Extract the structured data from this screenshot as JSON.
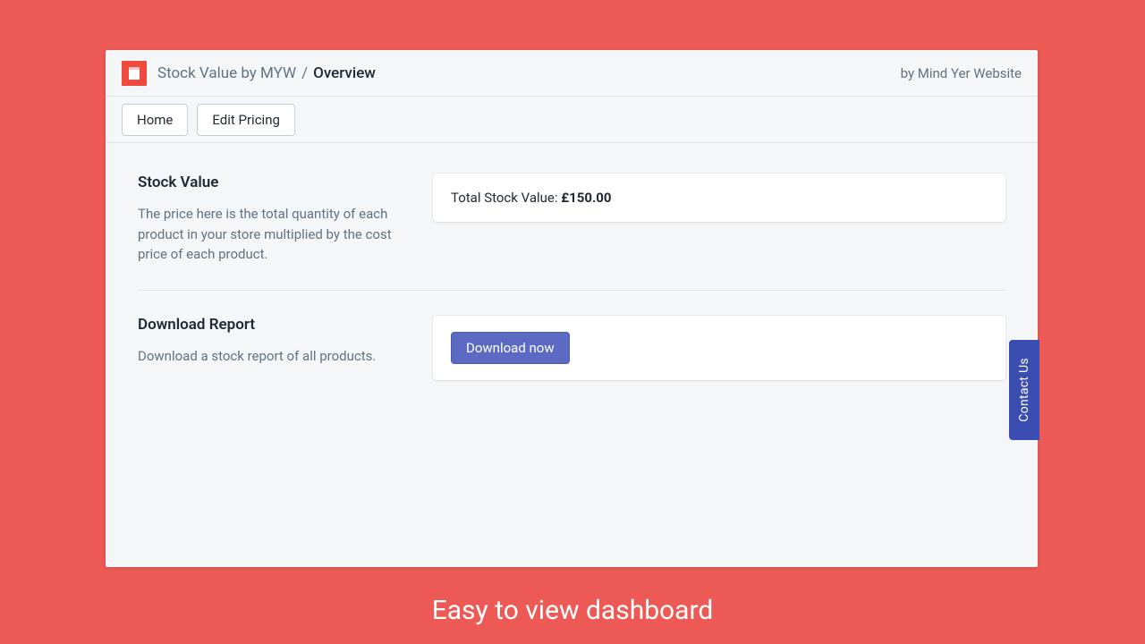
{
  "header": {
    "app_name": "Stock Value by MYW",
    "separator": "/",
    "current_page": "Overview",
    "byline": "by Mind Yer Website"
  },
  "toolbar": {
    "home_label": "Home",
    "edit_pricing_label": "Edit Pricing"
  },
  "sections": {
    "stock_value": {
      "title": "Stock Value",
      "description": "The price here is the total quantity of each product in your store multiplied by the cost price of each product.",
      "total_label": "Total Stock Value: ",
      "total_value": "£150.00"
    },
    "download_report": {
      "title": "Download Report",
      "description": "Download a stock report of all products.",
      "button_label": "Download now"
    }
  },
  "contact_tab": {
    "label": "Contact Us"
  },
  "tagline": "Easy to view dashboard"
}
